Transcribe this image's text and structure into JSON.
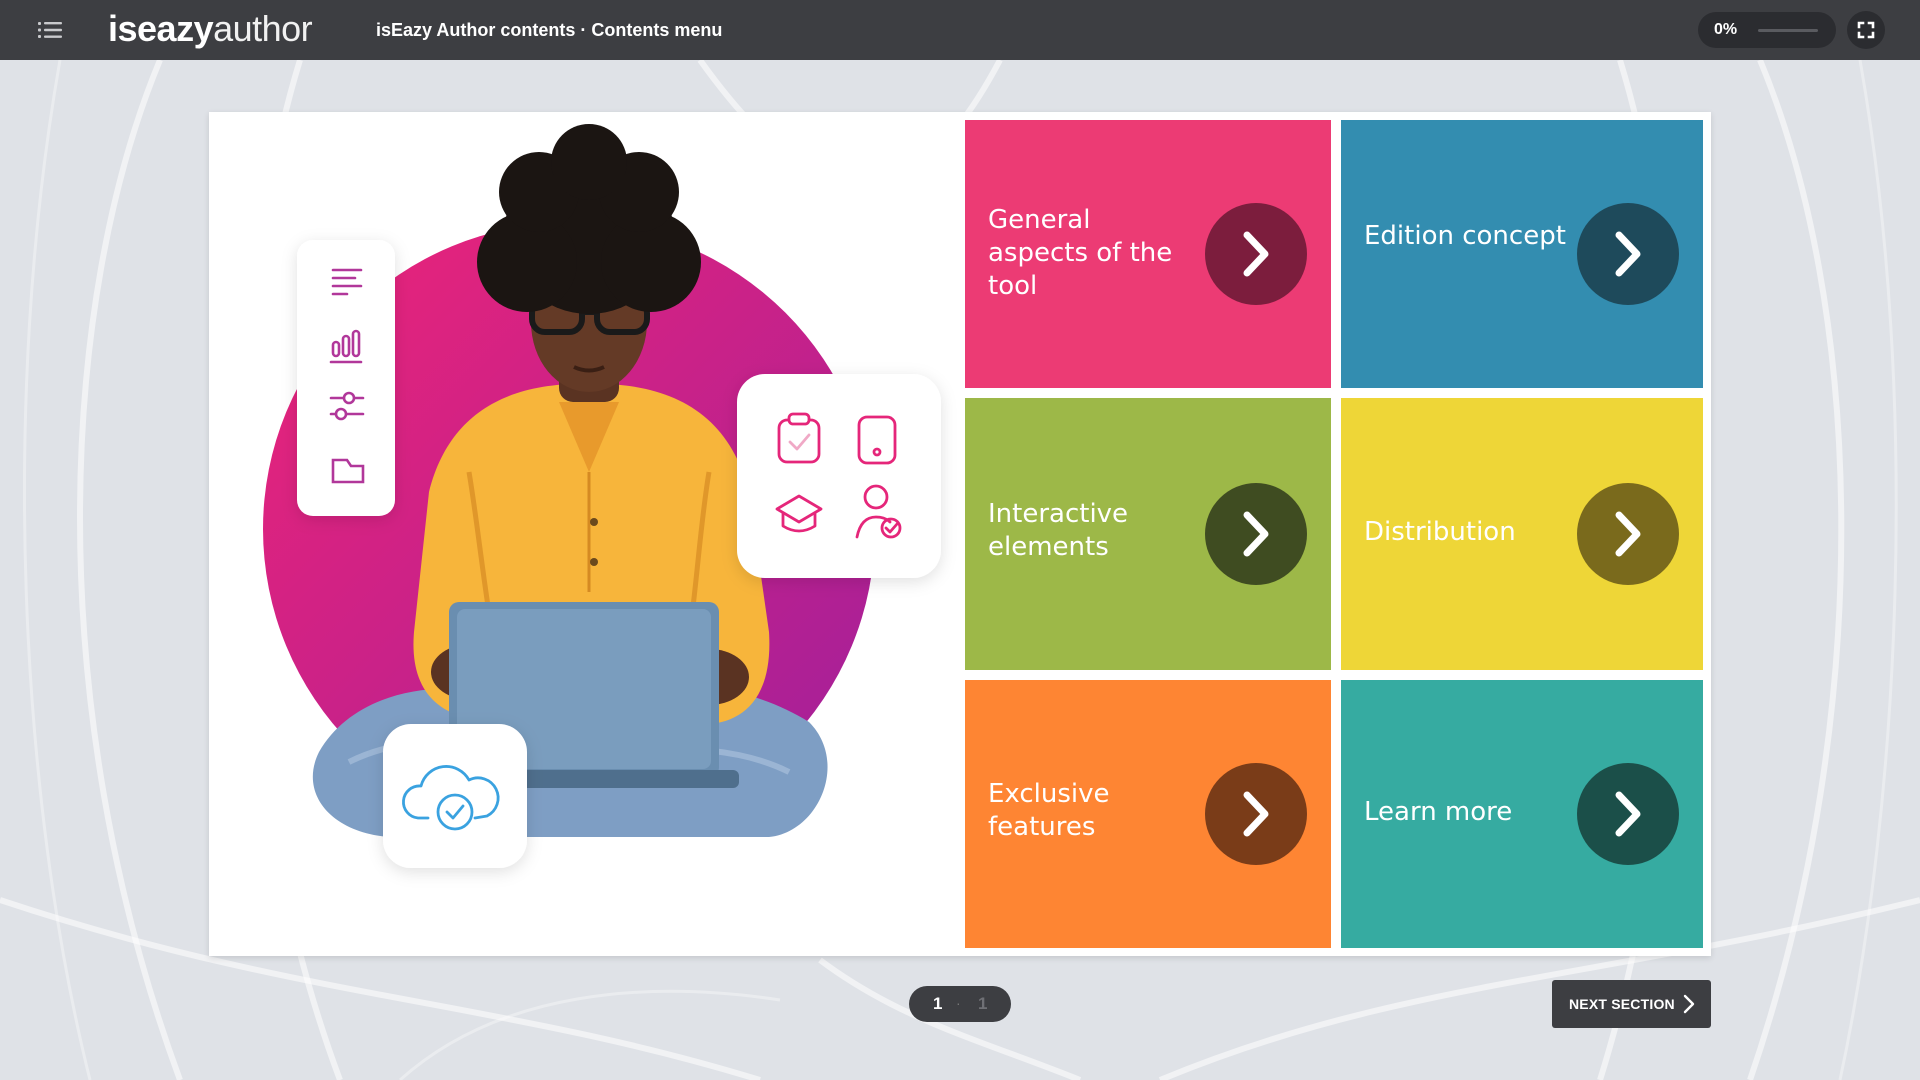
{
  "header": {
    "menu_icon": "list-menu-icon",
    "logo_bold": "iseazy",
    "logo_light": "author",
    "title": "isEazy Author contents · Contents menu",
    "progress": {
      "label": "0%",
      "value": 0
    },
    "fullscreen_icon": "fullscreen-icon"
  },
  "menu": {
    "tiles": [
      {
        "label": "General aspects of the tool",
        "color": "#ec3b74",
        "arrow_color": "#7c1d3d",
        "icon": "chevron-right-icon"
      },
      {
        "label": "Edition concept",
        "color": "#338db0",
        "arrow_color": "#1e4a5b",
        "icon": "chevron-right-icon"
      },
      {
        "label": "Interactive elements",
        "color": "#9db848",
        "arrow_color": "#3f4c21",
        "icon": "chevron-right-icon"
      },
      {
        "label": "Distribution",
        "color": "#eed637",
        "arrow_color": "#7a6a1c",
        "icon": "chevron-right-icon"
      },
      {
        "label": "Exclusive features",
        "color": "#fe8533",
        "arrow_color": "#7a3c18",
        "icon": "chevron-right-icon"
      },
      {
        "label": "Learn more",
        "color": "#36aba1",
        "arrow_color": "#1b4f49",
        "icon": "chevron-right-icon"
      }
    ]
  },
  "illustration": {
    "circle_gradient": [
      "#e8237b",
      "#a8209a"
    ],
    "icon_color": "#e5267a",
    "sidebar_icons": [
      "text-lines-icon",
      "bar-chart-icon",
      "sliders-icon",
      "folder-icon"
    ],
    "card_icons": [
      "clipboard-check-icon",
      "tablet-icon",
      "graduation-cap-icon",
      "user-check-icon"
    ],
    "cloud_icon": "cloud-check-icon"
  },
  "footer": {
    "page_current": "1",
    "page_separator": "·",
    "page_total": "1",
    "next_label": "NEXT SECTION",
    "next_icon": "chevron-right-icon"
  }
}
